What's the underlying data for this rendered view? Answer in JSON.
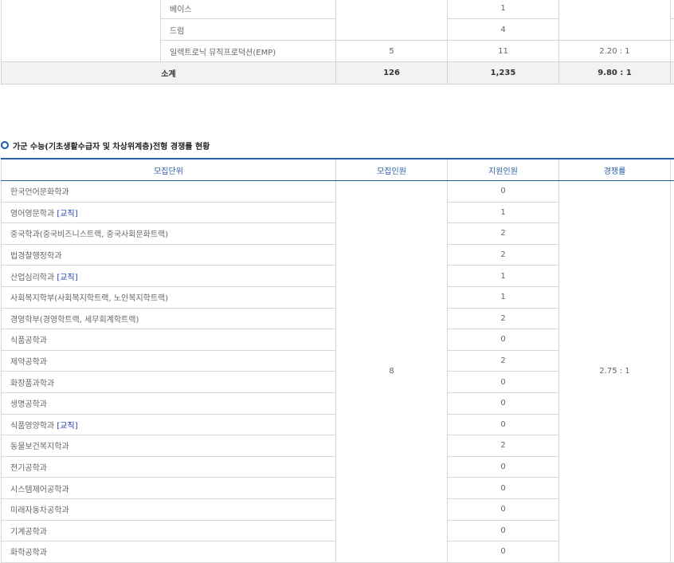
{
  "top_table": {
    "rows": [
      {
        "name": "베이스",
        "recruit": "",
        "applicants": "1",
        "ratio": ""
      },
      {
        "name": "드럼",
        "recruit": "",
        "applicants": "4",
        "ratio": ""
      },
      {
        "name": "일렉트로닉 뮤직프로덕션(EMP)",
        "recruit": "5",
        "applicants": "11",
        "ratio": "2.20 : 1"
      }
    ],
    "subtotal": {
      "label": "소계",
      "recruit": "126",
      "applicants": "1,235",
      "ratio": "9.80 : 1"
    }
  },
  "section": {
    "title": "가군 수능(기초생활수급자 및 차상위계층)전형 경쟁률 현황"
  },
  "main_table": {
    "headers": {
      "unit": "모집단위",
      "recruit": "모집인원",
      "applicants": "지원인원",
      "ratio": "경쟁률"
    },
    "recruit_total": "8",
    "ratio_total": "2.75 : 1",
    "rows": [
      {
        "name": "한국언어문화학과",
        "tag": "",
        "applicants": "0"
      },
      {
        "name": "영어영문학과 ",
        "tag": "[교직]",
        "applicants": "1"
      },
      {
        "name": "중국학과(중국비즈니스트랙, 중국사회문화트랙)",
        "tag": "",
        "applicants": "2"
      },
      {
        "name": "법경찰행정학과",
        "tag": "",
        "applicants": "2"
      },
      {
        "name": "산업심리학과 ",
        "tag": "[교직]",
        "applicants": "1"
      },
      {
        "name": "사회복지학부(사회복지학트랙, 노인복지학트랙)",
        "tag": "",
        "applicants": "1"
      },
      {
        "name": "경영학부(경영학트랙, 세무회계학트랙)",
        "tag": "",
        "applicants": "2"
      },
      {
        "name": "식품공학과",
        "tag": "",
        "applicants": "0"
      },
      {
        "name": "제약공학과",
        "tag": "",
        "applicants": "2"
      },
      {
        "name": "화장품과학과",
        "tag": "",
        "applicants": "0"
      },
      {
        "name": "생명공학과",
        "tag": "",
        "applicants": "0"
      },
      {
        "name": "식품영양학과 ",
        "tag": "[교직]",
        "applicants": "0"
      },
      {
        "name": "동물보건복지학과",
        "tag": "",
        "applicants": "2"
      },
      {
        "name": "전기공학과",
        "tag": "",
        "applicants": "0"
      },
      {
        "name": "시스템제어공학과",
        "tag": "",
        "applicants": "0"
      },
      {
        "name": "미래자동차공학과",
        "tag": "",
        "applicants": "0"
      },
      {
        "name": "기계공학과",
        "tag": "",
        "applicants": "0"
      },
      {
        "name": "화학공학과",
        "tag": "",
        "applicants": "0"
      }
    ]
  }
}
